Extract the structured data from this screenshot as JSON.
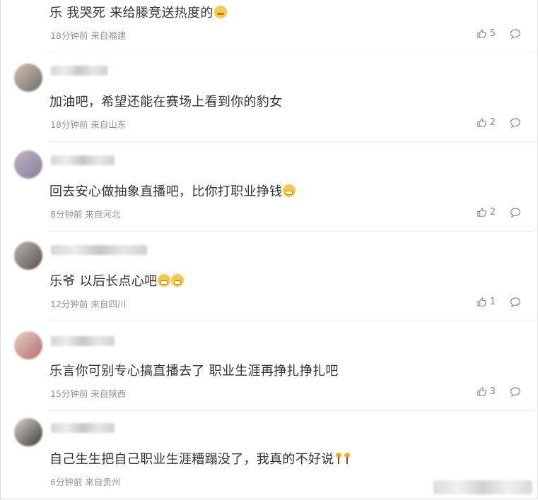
{
  "comments": [
    {
      "text": "乐 我哭死 来给滕竞送热度的",
      "meta": "18分钟前 来自福建",
      "likes": "5",
      "emoji": "cry"
    },
    {
      "text": "加油吧，希望还能在赛场上看到你的豹女",
      "meta": "18分钟前 来自山东",
      "likes": "2",
      "emoji": ""
    },
    {
      "text": "回去安心做抽象直播吧，比你打职业挣钱",
      "meta": "8分钟前 来自河北",
      "likes": "2",
      "emoji": "grin1"
    },
    {
      "text": "乐爷 以后长点心吧",
      "meta": "12分钟前 来自四川",
      "likes": "1",
      "emoji": "grin2"
    },
    {
      "text": "乐言你可别专心搞直播去了 职业生涯再挣扎挣扎吧",
      "meta": "15分钟前 来自陕西",
      "likes": "3",
      "emoji": ""
    },
    {
      "text": "自己生生把自己职业生涯糟蹋没了，我真的不好说",
      "meta": "6分钟前 来自贵州",
      "likes": "",
      "emoji": "torch"
    }
  ],
  "icons": {
    "like": "thumbs-up-icon",
    "reply": "comment-bubble-icon"
  },
  "colors": {
    "meta": "#939393",
    "text": "#333333",
    "divider": "#ececec"
  }
}
